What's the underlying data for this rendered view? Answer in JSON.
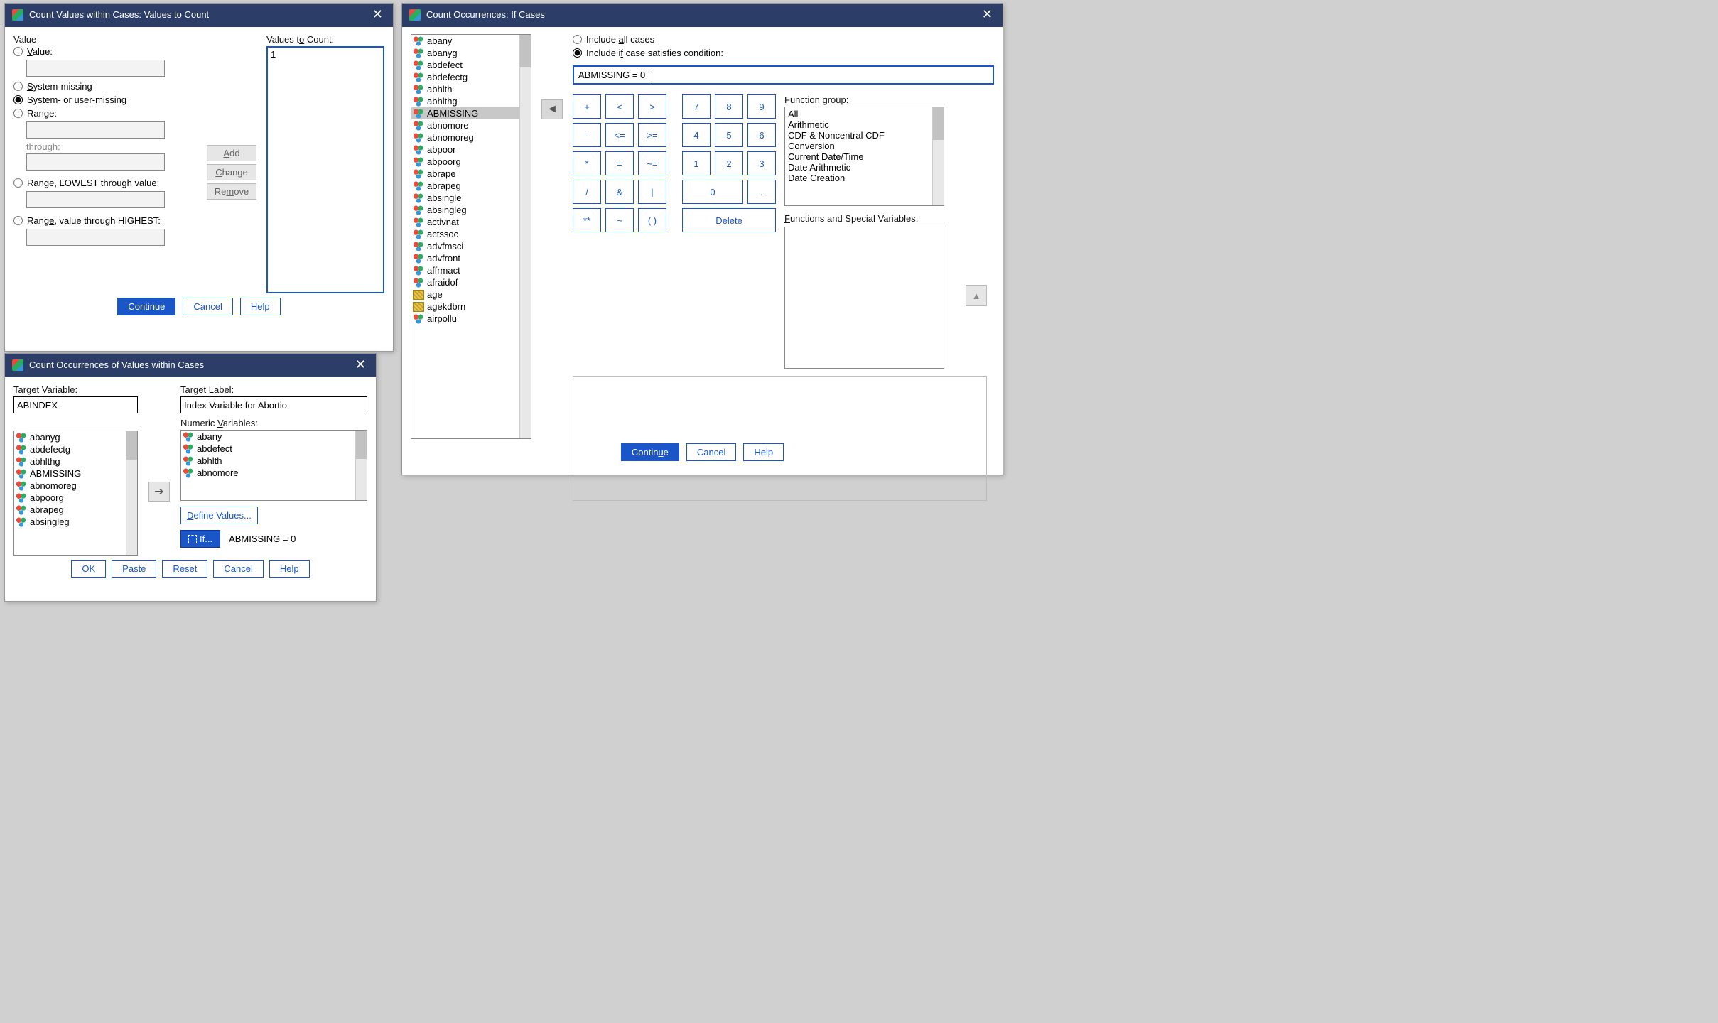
{
  "dlg1": {
    "title": "Count Values within Cases: Values to Count",
    "value_header": "Value",
    "values_to_count_header": "Values to Count:",
    "radio_value": "Value:",
    "radio_sysmiss": "System-missing",
    "radio_sysuser": "System- or user-missing",
    "radio_range": "Range:",
    "through": "through:",
    "radio_lowest": "Range, LOWEST through value:",
    "radio_highest": "Range, value through HIGHEST:",
    "add": "Add",
    "change": "Change",
    "remove": "Remove",
    "list_entry": "1",
    "continue": "Continue",
    "cancel": "Cancel",
    "help": "Help"
  },
  "dlg2": {
    "title": "Count Occurrences of Values within Cases",
    "target_var": "Target Variable:",
    "target_var_val": "ABINDEX",
    "target_label": "Target Label:",
    "target_label_val": "Index Variable for Abortio",
    "num_vars": "Numeric Variables:",
    "left_vars": [
      "abanyg",
      "abdefectg",
      "abhlthg",
      "ABMISSING",
      "abnomoreg",
      "abpoorg",
      "abrapeg",
      "absingleg"
    ],
    "right_vars": [
      "abany",
      "abdefect",
      "abhlth",
      "abnomore"
    ],
    "define_values": "Define Values...",
    "if_label": "If...",
    "if_expr": "ABMISSING = 0",
    "ok": "OK",
    "paste": "Paste",
    "reset": "Reset",
    "cancel": "Cancel",
    "help": "Help"
  },
  "dlg3": {
    "title": "Count Occurrences: If Cases",
    "include_all": "Include all cases",
    "include_if": "Include if case satisfies condition:",
    "expr": "ABMISSING = 0",
    "vars": [
      "abany",
      "abanyg",
      "abdefect",
      "abdefectg",
      "abhlth",
      "abhlthg",
      "ABMISSING",
      "abnomore",
      "abnomoreg",
      "abpoor",
      "abpoorg",
      "abrape",
      "abrapeg",
      "absingle",
      "absingleg",
      "activnat",
      "actssoc",
      "advfmsci",
      "advfront",
      "affrmact",
      "afraidof",
      "age",
      "agekdbrn",
      "airpollu"
    ],
    "selected_var_index": 6,
    "scale_var_indices": [
      21,
      22
    ],
    "keypad": {
      "r1": [
        "+",
        "<",
        ">",
        "7",
        "8",
        "9"
      ],
      "r2": [
        "-",
        "<=",
        ">=",
        "4",
        "5",
        "6"
      ],
      "r3": [
        "*",
        "=",
        "~=",
        "1",
        "2",
        "3"
      ],
      "r4": [
        "/",
        "&",
        "|",
        "0",
        "."
      ],
      "r5": [
        "**",
        "~",
        "( )",
        "Delete"
      ]
    },
    "fg_label": "Function group:",
    "fg_items": [
      "All",
      "Arithmetic",
      "CDF & Noncentral CDF",
      "Conversion",
      "Current Date/Time",
      "Date Arithmetic",
      "Date Creation"
    ],
    "fsv_label": "Functions and Special Variables:",
    "continue": "Continue",
    "cancel": "Cancel",
    "help": "Help"
  }
}
